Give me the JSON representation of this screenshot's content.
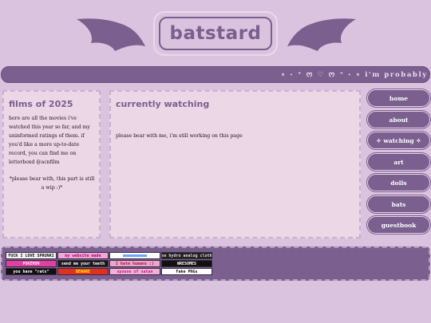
{
  "header": {
    "site_title": "batstard"
  },
  "marquee": {
    "text": "⋆ ˖ ⁺ ᰔ ♡ ᰔ ⁺ ˖ ⋆ i'm probably watching"
  },
  "left_panel": {
    "heading": "films of 2025",
    "intro": "here are all the movies i've watched this year so far, and my uninformed ratings of them. if you'd like a more up-to-date record, you can find me on letterboxd @acnfilm",
    "note": "*please bear with, this part is still a wip :)*"
  },
  "main_panel": {
    "heading": "currently watching",
    "text": "please bear with me, i'm still working on this page"
  },
  "nav": {
    "items": [
      {
        "label": "home"
      },
      {
        "label": "about"
      },
      {
        "label": "✧ watching ✧"
      },
      {
        "label": "art"
      },
      {
        "label": "dolls"
      },
      {
        "label": "bats"
      },
      {
        "label": "guestbook"
      }
    ]
  },
  "footer": {
    "stamps": [
      {
        "label": "FUCK I LOVE SPRUNKI",
        "bg": "#f2f2f2",
        "fg": "#111111"
      },
      {
        "label": "my website made",
        "bg": "#f0a8d8",
        "fg": "#a0106a"
      },
      {
        "label": "■■■■■■■■■■",
        "bg": "#ffffff",
        "fg": "#6aa0ff"
      },
      {
        "label": "I use hydro analog clothing",
        "bg": "#222222",
        "fg": "#dddddd"
      },
      {
        "label": "POKÉMON",
        "bg": "#e040a0",
        "fg": "#ffe0f0"
      },
      {
        "label": "send me your teeth",
        "bg": "#1a1a1a",
        "fg": "#ffffff"
      },
      {
        "label": "I hate humans :)",
        "bg": "#e8a8c8",
        "fg": "#b01060"
      },
      {
        "label": "WRESOMES",
        "bg": "#111111",
        "fg": "#ffffff"
      },
      {
        "label": "you have \"rats\"",
        "bg": "#111111",
        "fg": "#ffffff"
      },
      {
        "label": "BEWARE",
        "bg": "#e03020",
        "fg": "#ffee00"
      },
      {
        "label": "spouse of satan",
        "bg": "#f4b0d8",
        "fg": "#c02080"
      },
      {
        "label": "Fake PNGs",
        "bg": "#ffffff",
        "fg": "#111111"
      }
    ]
  },
  "colors": {
    "background": "#d9c3de",
    "accent": "#7a5f8f",
    "panel": "#ecd7e7"
  }
}
